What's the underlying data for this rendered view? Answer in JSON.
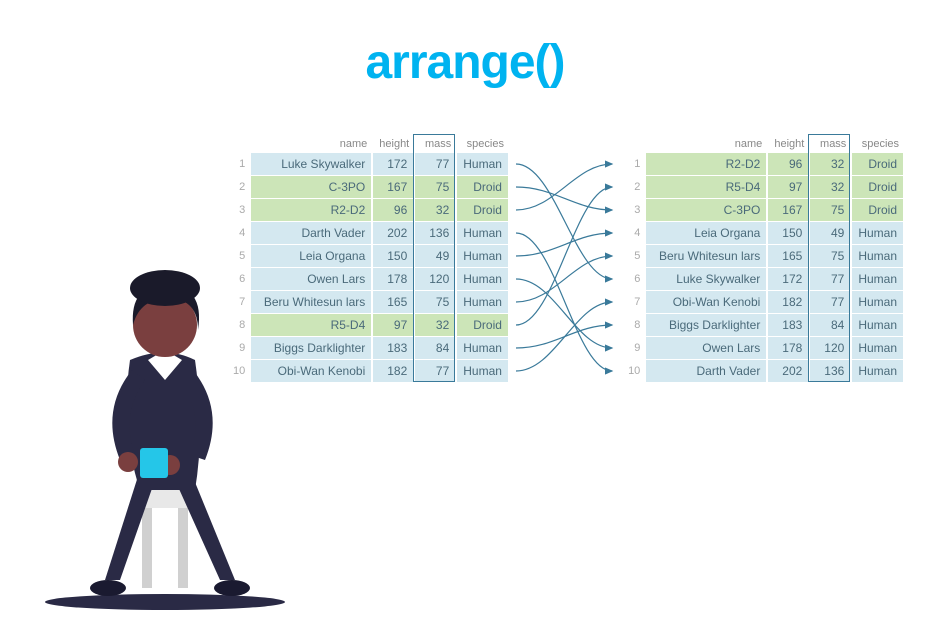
{
  "title": "arrange()",
  "headers": {
    "name": "name",
    "height": "height",
    "mass": "mass",
    "species": "species"
  },
  "left_table": [
    {
      "n": "1",
      "name": "Luke Skywalker",
      "height": "172",
      "mass": "77",
      "species": "Human",
      "droid": false
    },
    {
      "n": "2",
      "name": "C-3PO",
      "height": "167",
      "mass": "75",
      "species": "Droid",
      "droid": true
    },
    {
      "n": "3",
      "name": "R2-D2",
      "height": "96",
      "mass": "32",
      "species": "Droid",
      "droid": true
    },
    {
      "n": "4",
      "name": "Darth Vader",
      "height": "202",
      "mass": "136",
      "species": "Human",
      "droid": false
    },
    {
      "n": "5",
      "name": "Leia Organa",
      "height": "150",
      "mass": "49",
      "species": "Human",
      "droid": false
    },
    {
      "n": "6",
      "name": "Owen Lars",
      "height": "178",
      "mass": "120",
      "species": "Human",
      "droid": false
    },
    {
      "n": "7",
      "name": "Beru Whitesun lars",
      "height": "165",
      "mass": "75",
      "species": "Human",
      "droid": false
    },
    {
      "n": "8",
      "name": "R5-D4",
      "height": "97",
      "mass": "32",
      "species": "Droid",
      "droid": true
    },
    {
      "n": "9",
      "name": "Biggs Darklighter",
      "height": "183",
      "mass": "84",
      "species": "Human",
      "droid": false
    },
    {
      "n": "10",
      "name": "Obi-Wan Kenobi",
      "height": "182",
      "mass": "77",
      "species": "Human",
      "droid": false
    }
  ],
  "right_table": [
    {
      "n": "1",
      "name": "R2-D2",
      "height": "96",
      "mass": "32",
      "species": "Droid",
      "droid": true
    },
    {
      "n": "2",
      "name": "R5-D4",
      "height": "97",
      "mass": "32",
      "species": "Droid",
      "droid": true
    },
    {
      "n": "3",
      "name": "C-3PO",
      "height": "167",
      "mass": "75",
      "species": "Droid",
      "droid": true
    },
    {
      "n": "4",
      "name": "Leia Organa",
      "height": "150",
      "mass": "49",
      "species": "Human",
      "droid": false
    },
    {
      "n": "5",
      "name": "Beru Whitesun lars",
      "height": "165",
      "mass": "75",
      "species": "Human",
      "droid": false
    },
    {
      "n": "6",
      "name": "Luke Skywalker",
      "height": "172",
      "mass": "77",
      "species": "Human",
      "droid": false
    },
    {
      "n": "7",
      "name": "Obi-Wan Kenobi",
      "height": "182",
      "mass": "77",
      "species": "Human",
      "droid": false
    },
    {
      "n": "8",
      "name": "Biggs Darklighter",
      "height": "183",
      "mass": "84",
      "species": "Human",
      "droid": false
    },
    {
      "n": "9",
      "name": "Owen Lars",
      "height": "178",
      "mass": "120",
      "species": "Human",
      "droid": false
    },
    {
      "n": "10",
      "name": "Darth Vader",
      "height": "202",
      "mass": "136",
      "species": "Human",
      "droid": false
    }
  ],
  "arrow_map": [
    [
      1,
      6
    ],
    [
      2,
      3
    ],
    [
      3,
      1
    ],
    [
      4,
      10
    ],
    [
      5,
      4
    ],
    [
      6,
      9
    ],
    [
      7,
      5
    ],
    [
      8,
      2
    ],
    [
      9,
      8
    ],
    [
      10,
      7
    ]
  ],
  "colors": {
    "title": "#00b3f0",
    "cell_human": "#d4e8f0",
    "cell_droid": "#cce5b8",
    "border_mass": "#3a7a9a",
    "arrow": "#3a7a9a",
    "skin": "#7a3f3f",
    "suit": "#2a2a45",
    "cup": "#25c6e8"
  }
}
